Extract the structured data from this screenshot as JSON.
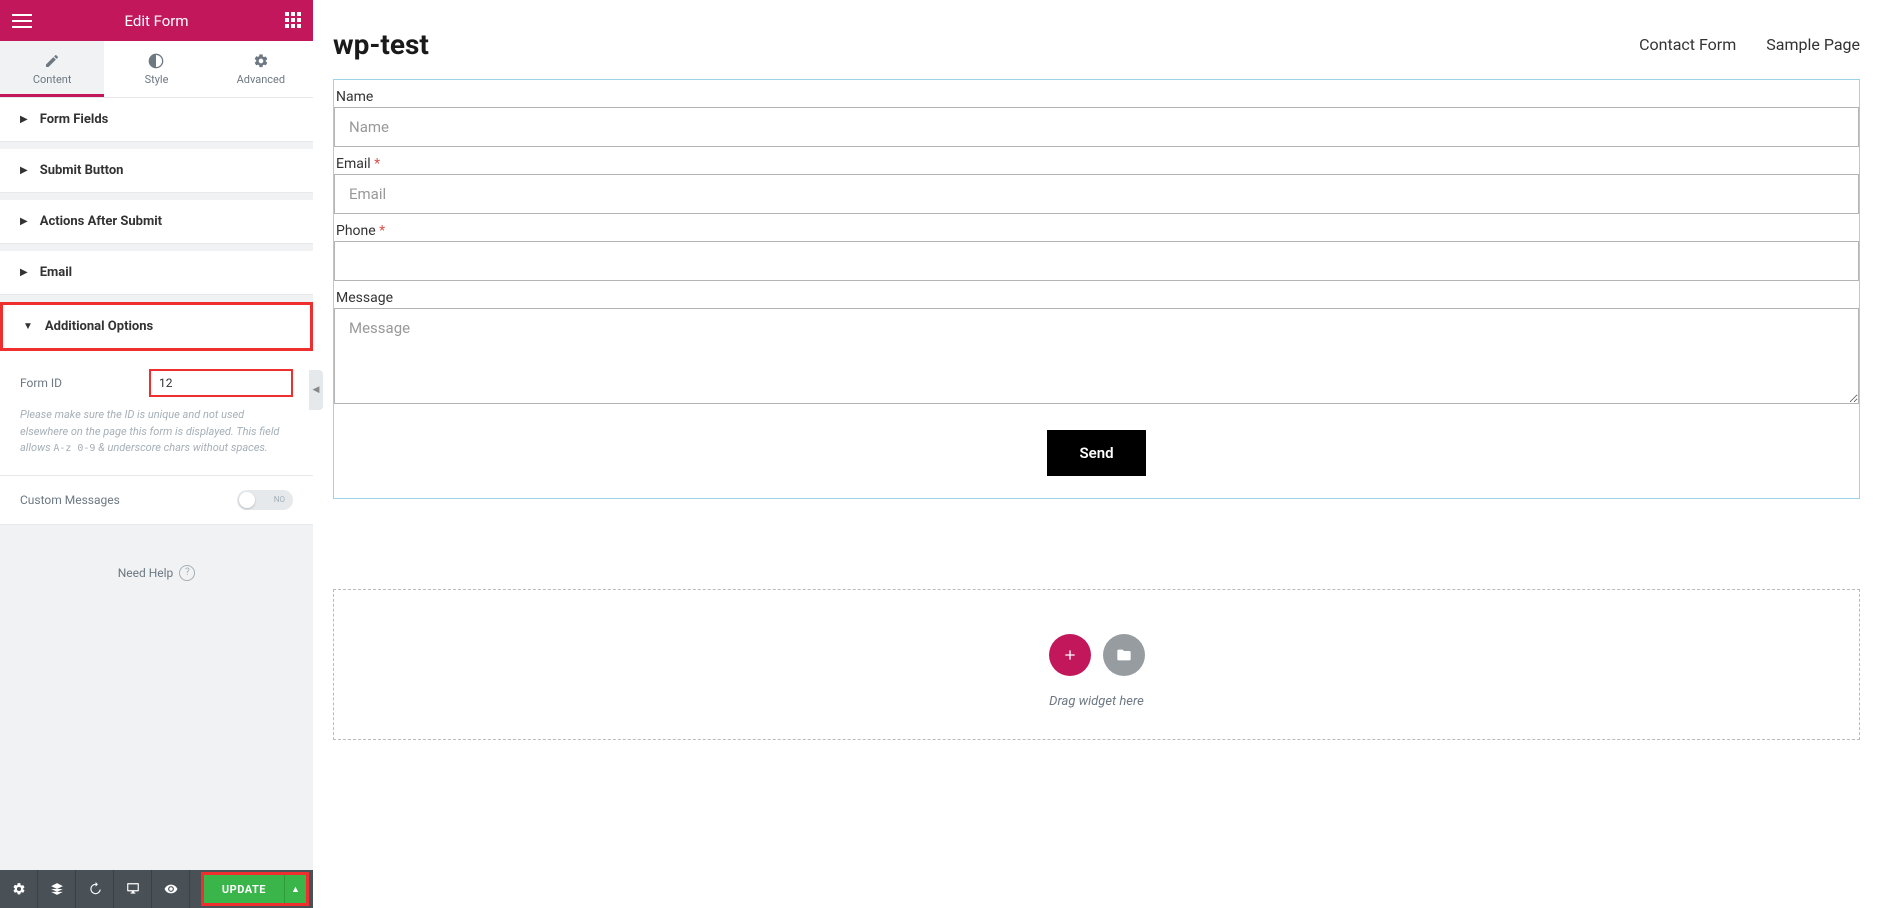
{
  "sidebar": {
    "title": "Edit Form",
    "tabs": [
      {
        "label": "Content"
      },
      {
        "label": "Style"
      },
      {
        "label": "Advanced"
      }
    ],
    "sections": [
      {
        "label": "Form Fields"
      },
      {
        "label": "Submit Button"
      },
      {
        "label": "Actions After Submit"
      },
      {
        "label": "Email"
      },
      {
        "label": "Additional Options"
      }
    ],
    "form_id": {
      "label": "Form ID",
      "value": "12",
      "help_pre": "Please make sure the ID is unique and not used elsewhere on the page this form is displayed. This field allows ",
      "help_code": "A-z 0-9",
      "help_post": " & underscore chars without spaces."
    },
    "custom_messages": {
      "label": "Custom Messages",
      "state": "NO"
    },
    "need_help": "Need Help",
    "footer": {
      "update": "UPDATE"
    }
  },
  "main": {
    "site_title": "wp-test",
    "nav": [
      {
        "label": "Contact Form"
      },
      {
        "label": "Sample Page"
      }
    ],
    "form": {
      "name": {
        "label": "Name",
        "placeholder": "Name",
        "required": false
      },
      "email": {
        "label": "Email",
        "placeholder": "Email",
        "required": true
      },
      "phone": {
        "label": "Phone",
        "placeholder": "",
        "required": true
      },
      "message": {
        "label": "Message",
        "placeholder": "Message",
        "required": false
      },
      "submit": "Send"
    },
    "dropzone": {
      "hint": "Drag widget here"
    }
  }
}
